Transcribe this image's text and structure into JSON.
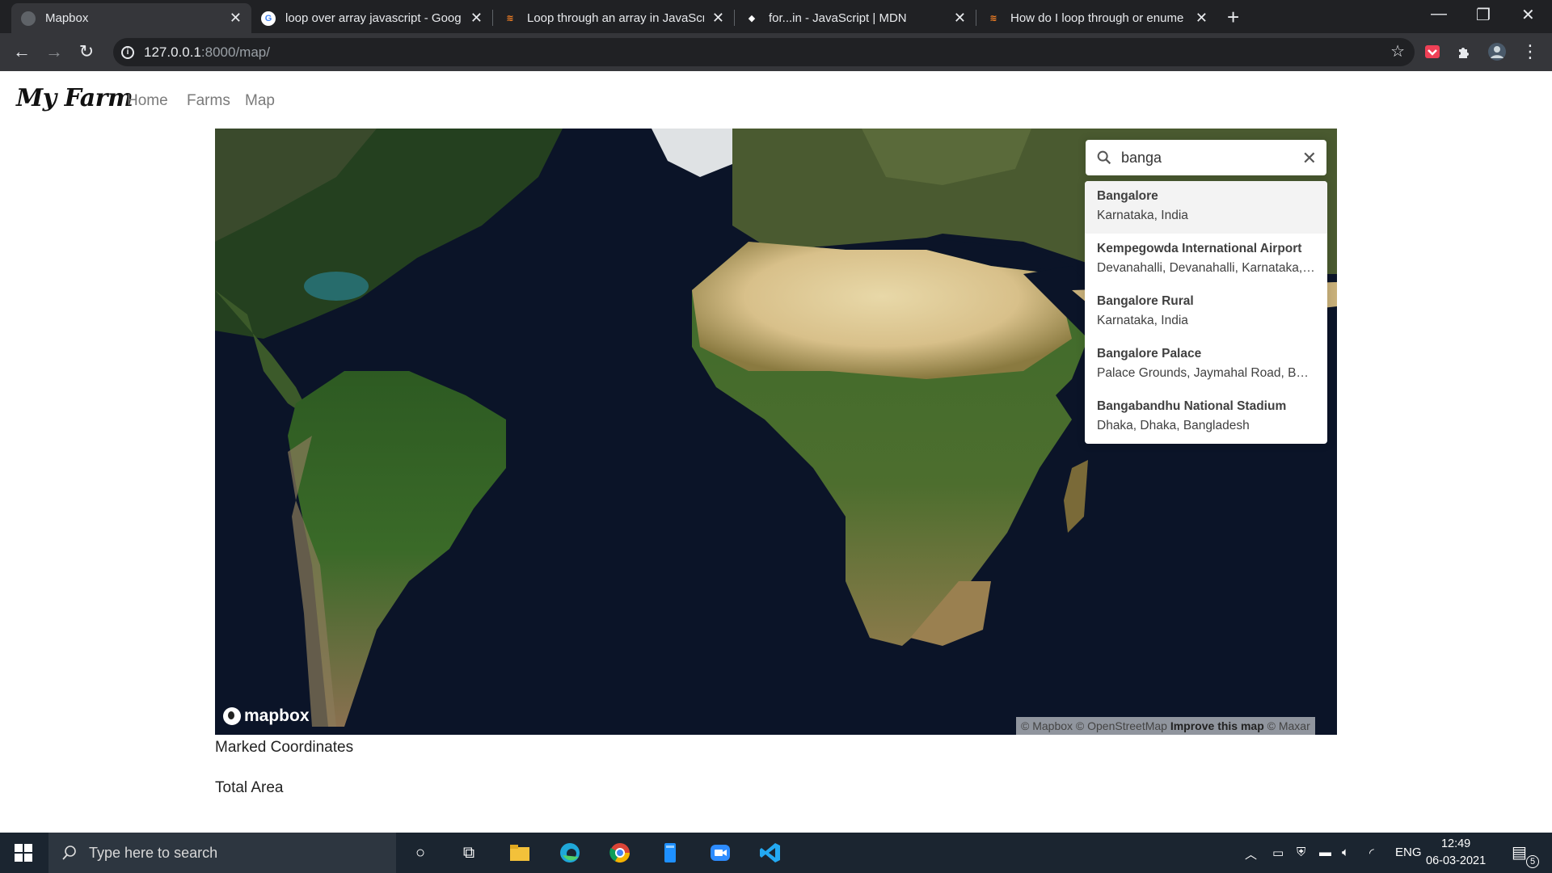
{
  "browser": {
    "tabs": [
      {
        "title": "Mapbox",
        "favicon": "mapbox-icon"
      },
      {
        "title": "loop over array javascript - Goog",
        "favicon": "google-icon"
      },
      {
        "title": "Loop through an array in JavaScr",
        "favicon": "stackoverflow-icon"
      },
      {
        "title": "for...in - JavaScript | MDN",
        "favicon": "mdn-icon"
      },
      {
        "title": "How do I loop through or enume",
        "favicon": "stackoverflow-icon"
      }
    ],
    "address": {
      "host": "127.0.0.1",
      "path": ":8000/map/"
    }
  },
  "navbar": {
    "brand": "My Farm",
    "links": [
      "Home",
      "Farms",
      "Map"
    ]
  },
  "geocoder": {
    "query": "banga",
    "suggestions": [
      {
        "name": "Bangalore",
        "address": "Karnataka, India"
      },
      {
        "name": "Kempegowda International Airport",
        "address": "Devanahalli, Devanahalli, Karnataka, India"
      },
      {
        "name": "Bangalore Rural",
        "address": "Karnataka, India"
      },
      {
        "name": "Bangalore Palace",
        "address": "Palace Grounds, Jaymahal Road, Bangalore, India"
      },
      {
        "name": "Bangabandhu National Stadium",
        "address": "Dhaka, Dhaka, Bangladesh"
      }
    ]
  },
  "map": {
    "logo": "mapbox",
    "attribution": {
      "mapbox": "© Mapbox",
      "osm": "© OpenStreetMap",
      "improve": "Improve this map",
      "maxar": "© Maxar"
    }
  },
  "page": {
    "marked_coordinates": "Marked Coordinates",
    "total_area": "Total Area"
  },
  "taskbar": {
    "search_placeholder": "Type here to search",
    "language": "ENG",
    "time": "12:49",
    "date": "06-03-2021",
    "notifications": "5"
  }
}
